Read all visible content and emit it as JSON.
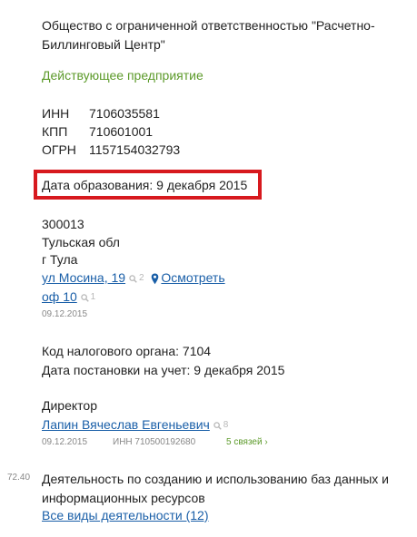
{
  "company": {
    "full_name_line1": "Общество с ограниченной ответственностью \"Расчетно-",
    "full_name_line2": "Биллинговый Центр\"",
    "status": "Действующее предприятие"
  },
  "ids": {
    "inn_label": "ИНН",
    "inn_value": "7106035581",
    "kpp_label": "КПП",
    "kpp_value": "710601001",
    "ogrn_label": "ОГРН",
    "ogrn_value": "1157154032793"
  },
  "founded": {
    "text": "Дата образования: 9 декабря 2015"
  },
  "address": {
    "postal_code": "300013",
    "region": "Тульская обл",
    "city": "г Тула",
    "street_link": "ул Мосина, 19",
    "street_count": "2",
    "view_link": "Осмотреть",
    "office_link": "оф 10",
    "office_count": "1",
    "date": "09.12.2015"
  },
  "tax": {
    "authority_code": "Код налогового органа: 7104",
    "registration_date": "Дата постановки на учет: 9 декабря 2015"
  },
  "director": {
    "title": "Директор",
    "name_link": "Лапин Вячеслав Евгеньевич",
    "name_count": "8",
    "date": "09.12.2015",
    "inn": "ИНН 710500192680",
    "connections": "5 связей ›"
  },
  "activity": {
    "code": "72.40",
    "line1": "Деятельность по созданию и использованию баз данных и",
    "line2": "информационных ресурсов",
    "all_link": "Все виды деятельности (12)"
  },
  "colors": {
    "link": "#1a5fa8",
    "status_green": "#5c9a2a",
    "highlight_red": "#d7191e",
    "muted": "#888888"
  },
  "icons": {
    "search_count": "magnifier-icon",
    "map_pin": "map-pin-icon"
  }
}
